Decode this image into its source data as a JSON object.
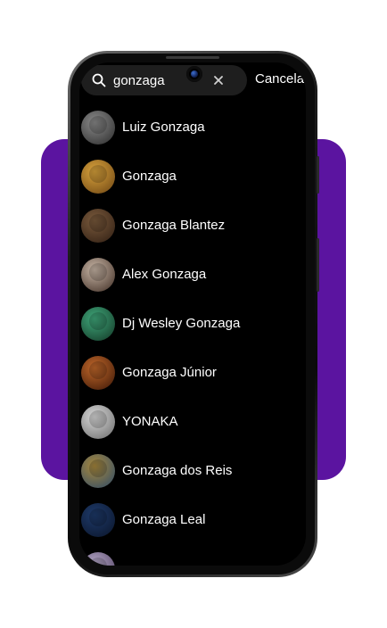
{
  "search": {
    "query": "gonzaga",
    "cancel_label": "Cancelar"
  },
  "results": [
    {
      "name": "Luiz Gonzaga",
      "avatar_color": "#8a8a8a",
      "avatar_color2": "#2a2a2a"
    },
    {
      "name": "Gonzaga",
      "avatar_color": "#d9a33c",
      "avatar_color2": "#6b4313"
    },
    {
      "name": "Gonzaga Blantez",
      "avatar_color": "#7a5a3c",
      "avatar_color2": "#2e1d12"
    },
    {
      "name": "Alex Gonzaga",
      "avatar_color": "#c8b6a6",
      "avatar_color2": "#3d2b22"
    },
    {
      "name": "Dj Wesley Gonzaga",
      "avatar_color": "#3fa77a",
      "avatar_color2": "#123524"
    },
    {
      "name": "Gonzaga Júnior",
      "avatar_color": "#c0672a",
      "avatar_color2": "#3a1606"
    },
    {
      "name": "YONAKA",
      "avatar_color": "#d8d8d8",
      "avatar_color2": "#6a6a6a"
    },
    {
      "name": "Gonzaga dos Reis",
      "avatar_color": "#a8883c",
      "avatar_color2": "#2c4a6a"
    },
    {
      "name": "Gonzaga Leal",
      "avatar_color": "#1e3a6a",
      "avatar_color2": "#0a1428"
    },
    {
      "name": "",
      "avatar_color": "#b5a8c8",
      "avatar_color2": "#4a3a5a"
    }
  ]
}
